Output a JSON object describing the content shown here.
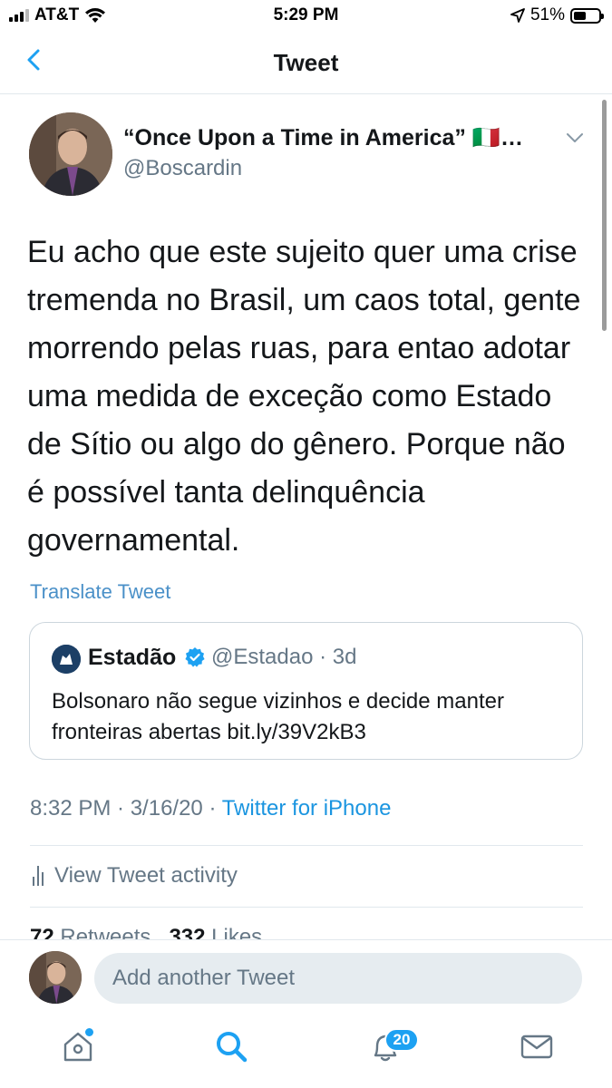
{
  "status_bar": {
    "carrier": "AT&T",
    "time": "5:29 PM",
    "battery_percent": "51%",
    "battery_level": 0.51,
    "icons": [
      "signal-icon",
      "wifi-icon",
      "location-icon",
      "battery-icon"
    ]
  },
  "nav": {
    "title": "Tweet",
    "back_icon": "chevron-left-icon"
  },
  "tweet": {
    "author_name": "“Once Upon a Time in America” 🇮🇹…",
    "author_handle": "@Boscardin",
    "text": "Eu acho que este sujeito quer uma crise tremenda no Brasil, um caos total, gente morrendo pelas ruas, para entao adotar uma medida de exceção como Estado de Sítio ou algo do gênero. Porque não é possível tanta delinquência governamental.",
    "translate_label": "Translate Tweet",
    "quote": {
      "name": "Estadão",
      "meta": "@Estadao · 3d",
      "text": "Bolsonaro não segue vizinhos e decide manter fronteiras abertas bit.ly/39V2kB3"
    },
    "timestamp": "8:32 PM · 3/16/20 · ",
    "source": "Twitter for iPhone",
    "activity_label": "View Tweet activity",
    "retweets_count": "72",
    "retweets_label": "Retweets",
    "likes_count": "332",
    "likes_label": "Likes"
  },
  "reply": {
    "placeholder": "Add another Tweet"
  },
  "tab_bar": {
    "items": [
      "home-icon",
      "search-icon",
      "notifications-icon",
      "messages-icon"
    ],
    "notifications_badge": "20"
  },
  "colors": {
    "accent": "#1da1f2",
    "link": "#1b95e0",
    "secondary_text": "#657786",
    "divider": "#e1e8ed"
  }
}
